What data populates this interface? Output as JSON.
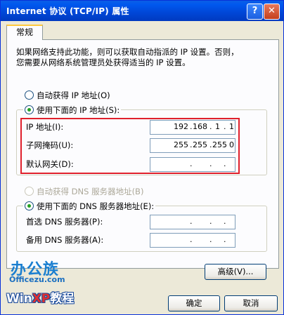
{
  "window": {
    "title": "Internet 协议 (TCP/IP) 属性",
    "help_glyph": "?",
    "close_glyph": "✕"
  },
  "tab": {
    "label": "常规"
  },
  "description": {
    "line1": "如果网络支持此功能，则可以获取自动指派的 IP 设置。否则，",
    "line2": "您需要从网络系统管理员处获得适当的 IP 设置。"
  },
  "ip_section": {
    "auto_label": "自动获得 IP 地址(O)",
    "manual_label": "使用下面的 IP 地址(S):",
    "auto_selected": false,
    "manual_selected": true,
    "fields": [
      {
        "label": "IP 地址(I):",
        "octets": [
          "192",
          "168",
          "1",
          "1"
        ]
      },
      {
        "label": "子网掩码(U):",
        "octets": [
          "255",
          "255",
          "255",
          "0"
        ]
      },
      {
        "label": "默认网关(D):",
        "octets": [
          "",
          "",
          "",
          ""
        ]
      }
    ]
  },
  "dns_section": {
    "auto_label": "自动获得 DNS 服务器地址(B)",
    "manual_label": "使用下面的 DNS 服务器地址(E):",
    "auto_selected": false,
    "manual_selected": true,
    "fields": [
      {
        "label": "首选 DNS 服务器(P):",
        "octets": [
          "",
          "",
          "",
          ""
        ]
      },
      {
        "label": "备用 DNS 服务器(A):",
        "octets": [
          "",
          "",
          "",
          ""
        ]
      }
    ]
  },
  "buttons": {
    "advanced": "高级(V)...",
    "ok": "确定",
    "cancel": "取消"
  },
  "watermark": {
    "brand": "办公族",
    "site": "Officezu.com",
    "win": "Win",
    "xp": "XP",
    "jc": "教程"
  }
}
